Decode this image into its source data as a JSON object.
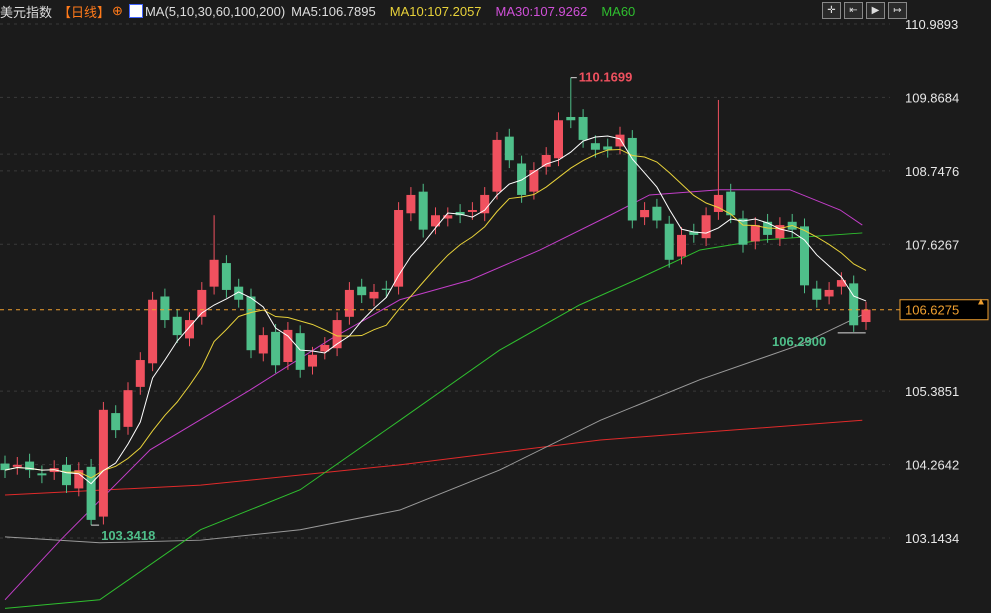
{
  "header": {
    "name": "美元指数",
    "period": "【日线】",
    "ma_def": "MA(5,10,30,60,100,200)",
    "ma5": "MA5:106.7895",
    "ma10": "MA10:107.2057",
    "ma30": "MA30:107.9262",
    "ma60": "MA60"
  },
  "toolbar": [
    "crosshair",
    "zoom-start",
    "play",
    "exit"
  ],
  "colors": {
    "up": "#f0515f",
    "down": "#4fbf8a",
    "ma5": "#ffffff",
    "ma10": "#e8d23a",
    "ma30": "#c23ec8",
    "ma60": "#2fbf2f",
    "ma100": "#9a9a9a",
    "ma200": "#e02a2a"
  },
  "chart_data": {
    "type": "candlestick",
    "title": "美元指数 日线",
    "y_ticks": [
      "110.9893",
      "109.8684",
      "108.7476",
      "107.6267",
      "105.3851",
      "104.2642",
      "103.1434"
    ],
    "ylim": [
      103.1434,
      110.9893
    ],
    "current_price": "106.6275",
    "annotations": {
      "high": "110.1699",
      "low": "103.3418",
      "recent_low": "106.2900"
    },
    "closes": [
      104.18,
      104.26,
      104.18,
      104.1,
      104.21,
      103.95,
      104.18,
      103.42,
      105.1,
      104.79,
      105.4,
      105.86,
      106.78,
      106.47,
      106.24,
      106.47,
      106.93,
      107.39,
      106.93,
      106.78,
      106.01,
      106.24,
      105.78,
      106.32,
      105.71,
      105.94,
      106.09,
      106.47,
      106.93,
      106.85,
      106.9,
      106.93,
      108.15,
      108.38,
      107.85,
      108.07,
      108.07,
      108.07,
      108.15,
      108.38,
      109.22,
      108.91,
      108.38,
      108.76,
      108.99,
      109.52,
      109.52,
      109.22,
      109.07,
      109.07,
      109.3,
      107.99,
      108.15,
      107.99,
      107.39,
      107.77,
      107.77,
      108.07,
      108.38,
      108.07,
      107.62,
      107.92,
      107.77,
      107.92,
      107.85,
      107.0,
      106.78,
      106.93,
      107.08,
      106.39,
      106.63
    ],
    "special": {
      "7": {
        "low": 103.34
      },
      "46": {
        "high": 110.17
      },
      "58": {
        "high": 109.83
      },
      "69": {
        "low": 106.29
      },
      "17": {
        "high": 108.07
      }
    },
    "ma30": [
      [
        0,
        102.2
      ],
      [
        4.5,
        103.11
      ],
      [
        11.8,
        104.49
      ],
      [
        19.9,
        105.4
      ],
      [
        26.4,
        106.17
      ],
      [
        32.1,
        106.78
      ],
      [
        37.8,
        107.08
      ],
      [
        43.5,
        107.54
      ],
      [
        49.2,
        108.07
      ],
      [
        52.4,
        108.38
      ],
      [
        58.1,
        108.46
      ],
      [
        63.8,
        108.46
      ],
      [
        67.9,
        108.15
      ],
      [
        69.7,
        107.92
      ]
    ],
    "ma60": [
      [
        0,
        102.07
      ],
      [
        7.7,
        102.2
      ],
      [
        15.9,
        103.27
      ],
      [
        24,
        103.88
      ],
      [
        32.1,
        104.94
      ],
      [
        40.2,
        106.01
      ],
      [
        46.7,
        106.7
      ],
      [
        51.6,
        107.11
      ],
      [
        56.5,
        107.54
      ],
      [
        61.4,
        107.69
      ],
      [
        69.7,
        107.8
      ]
    ],
    "ma100": [
      [
        0,
        103.16
      ],
      [
        7.7,
        103.07
      ],
      [
        15.9,
        103.11
      ],
      [
        24,
        103.27
      ],
      [
        32.1,
        103.57
      ],
      [
        40.2,
        104.18
      ],
      [
        48.4,
        104.94
      ],
      [
        56.5,
        105.56
      ],
      [
        64.6,
        106.09
      ],
      [
        69.7,
        106.55
      ]
    ],
    "ma200": [
      [
        0,
        103.8
      ],
      [
        15.9,
        103.95
      ],
      [
        32.1,
        104.26
      ],
      [
        48.4,
        104.64
      ],
      [
        69.7,
        104.94
      ]
    ]
  }
}
